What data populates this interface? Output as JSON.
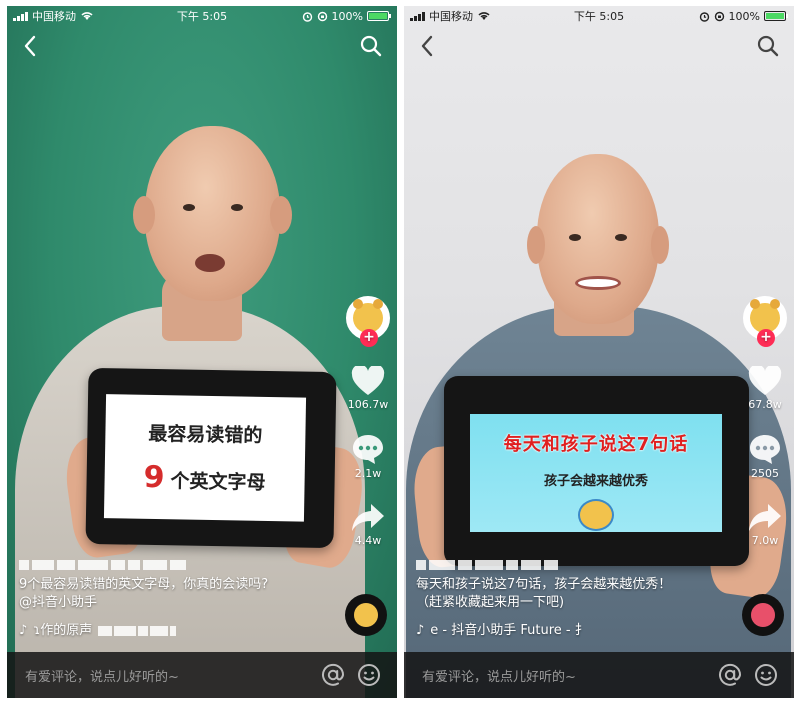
{
  "left": {
    "status": {
      "carrier": "中国移动",
      "time": "下午 5:05",
      "battery": "100%"
    },
    "tablet": {
      "line1": "最容易读错的",
      "number": "9",
      "line2": "个英文字母"
    },
    "likes": "106.7w",
    "comments": "2.1w",
    "shares": "4.4w",
    "caption": "9个最容易读错的英文字母，你真的会读吗?",
    "mention": "@抖音小助手",
    "music": "ɿ作的原声",
    "comment_placeholder": "有爱评论，说点儿好听的~"
  },
  "right": {
    "status": {
      "carrier": "中国移动",
      "time": "下午 5:05",
      "battery": "100%"
    },
    "tablet": {
      "headline": "每天和孩子说这7句话",
      "sub": "孩子会越来越优秀"
    },
    "likes": "67.8w",
    "comments": "2505",
    "shares": "7.0w",
    "caption": "每天和孩子说这7句话，孩子会越来越优秀！",
    "caption2": "（赶紧收藏起来用一下吧)",
    "music": "e - 抖音小助手    Future - 扌",
    "comment_placeholder": "有爱评论，说点儿好听的~"
  },
  "icons": [
    "signal-icon",
    "wifi-icon",
    "alarm-icon",
    "battery-icon",
    "back-icon",
    "search-icon",
    "heart-icon",
    "comment-icon",
    "share-icon",
    "music-note-icon",
    "at-icon",
    "emoji-icon",
    "follow-plus-icon"
  ],
  "colors": {
    "accent": "#fe2c55",
    "battery": "#4cd964",
    "tablet_red": "#e02020"
  }
}
